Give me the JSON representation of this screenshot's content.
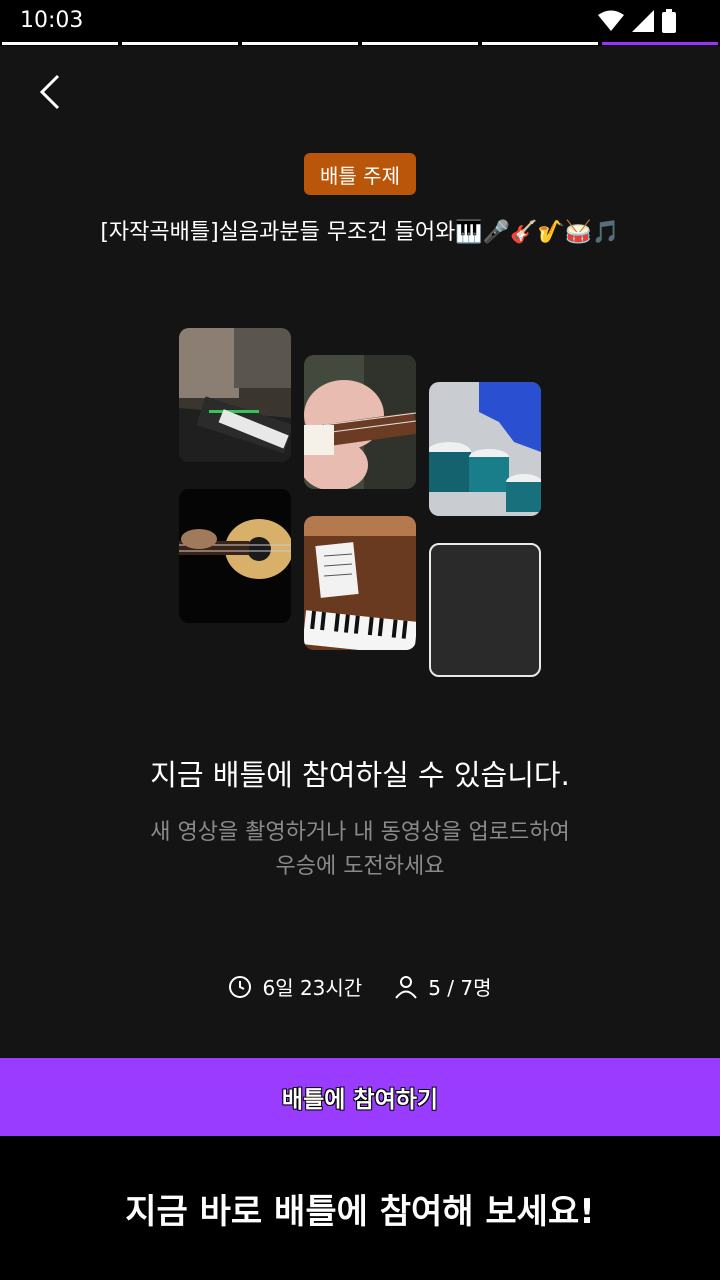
{
  "status_bar": {
    "time": "10:03",
    "icons": [
      "wifi-icon",
      "cell-signal-icon",
      "battery-icon"
    ]
  },
  "progress": {
    "segments": 6,
    "current_index": 5,
    "done_color": "#ffffff",
    "active_color": "#9a32ff"
  },
  "header": {
    "back_icon": "chevron-left-icon",
    "topic_badge": "배틀 주제",
    "topic_title": "[자작곡배틀]실음과분들 무조건 들어와🎹🎤🎸🎷🥁🎵"
  },
  "gallery": {
    "tiles": [
      {
        "name": "keyboard-video-thumbnail"
      },
      {
        "name": "electric-guitar-video-thumbnail"
      },
      {
        "name": "drums-video-thumbnail"
      },
      {
        "name": "acoustic-guitar-video-thumbnail"
      },
      {
        "name": "piano-video-thumbnail"
      },
      {
        "name": "empty-slot"
      }
    ]
  },
  "main": {
    "headline": "지금 배틀에 참여하실 수 있습니다.",
    "subtext_line1": "새 영상을 촬영하거나 내 동영상을 업로드하여",
    "subtext_line2": "우승에 도전하세요"
  },
  "meta": {
    "time_left": "6일 23시간",
    "participants": "5 / 7명"
  },
  "join_button": "배틀에 참여하기",
  "footer": "지금 바로 배틀에 참여해 보세요!",
  "colors": {
    "accent": "#9a3cff",
    "badge": "#b9560a",
    "background": "#141414"
  }
}
